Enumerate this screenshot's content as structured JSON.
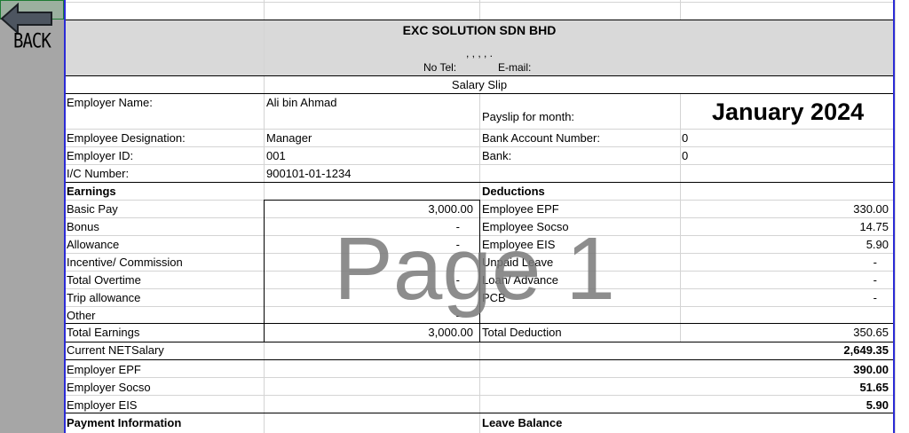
{
  "back_button": {
    "label": "BACK",
    "icon": "arrow-left-icon"
  },
  "header": {
    "company": "EXC SOLUTION SDN BHD",
    "address": ", , , , .",
    "tel_label": "No Tel:",
    "email_label": "E-mail:",
    "slip_title": "Salary Slip"
  },
  "employee": {
    "name_label": "Employer Name:",
    "name": "Ali bin Ahmad",
    "payslip_label": "Payslip for month:",
    "month": "January 2024",
    "designation_label": "Employee Designation:",
    "designation": "Manager",
    "bank_acc_label": "Bank Account Number:",
    "bank_acc": "0",
    "id_label": "Employer ID:",
    "id": "001",
    "bank_label": "Bank:",
    "bank": "0",
    "ic_label": "I/C Number:",
    "ic": "900101-01-1234"
  },
  "earnings": {
    "heading": "Earnings",
    "rows": [
      {
        "label": "Basic Pay",
        "value": "3,000.00"
      },
      {
        "label": "Bonus",
        "value": "-"
      },
      {
        "label": "Allowance",
        "value": "-"
      },
      {
        "label": "Incentive/ Commission",
        "value": ""
      },
      {
        "label": "Total Overtime",
        "value": "-"
      },
      {
        "label": "Trip allowance",
        "value": ""
      },
      {
        "label": "Other",
        "value": "-"
      }
    ],
    "total_label": "Total Earnings",
    "total": "3,000.00"
  },
  "deductions": {
    "heading": "Deductions",
    "rows": [
      {
        "label": "Employee EPF",
        "value": "330.00"
      },
      {
        "label": "Employee Socso",
        "value": "14.75"
      },
      {
        "label": "Employee EIS",
        "value": "5.90"
      },
      {
        "label": "Unpaid Leave",
        "value": "-"
      },
      {
        "label": "Loan/  Advance",
        "value": "-"
      },
      {
        "label": "PCB",
        "value": "-"
      }
    ],
    "total_label": "Total Deduction",
    "total": "350.65"
  },
  "net": {
    "label": "Current NETSalary",
    "value": "2,649.35"
  },
  "employer": [
    {
      "label": "Employer EPF",
      "value": "390.00"
    },
    {
      "label": "Employer Socso",
      "value": "51.65"
    },
    {
      "label": "Employer EIS",
      "value": "5.90"
    }
  ],
  "footer": {
    "payment_info": "Payment Information",
    "leave_balance": "Leave Balance"
  },
  "watermark": "Page 1"
}
